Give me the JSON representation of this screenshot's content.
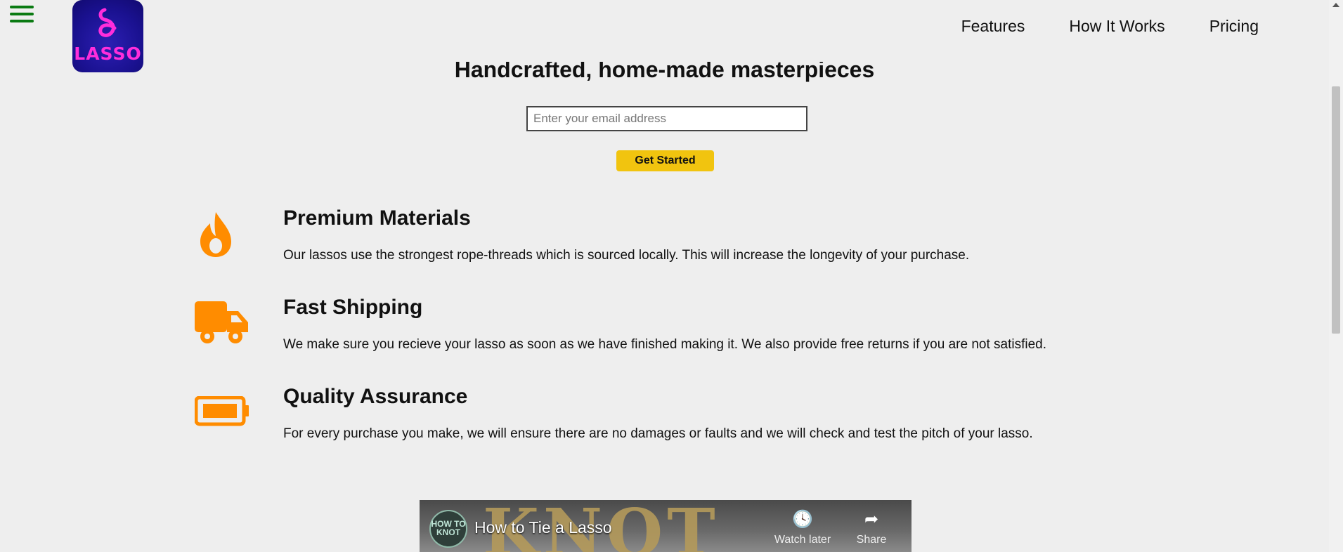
{
  "header": {
    "logo_text": "LASSO",
    "nav": [
      {
        "label": "Features"
      },
      {
        "label": "How It Works"
      },
      {
        "label": "Pricing"
      }
    ]
  },
  "hero": {
    "title": "Handcrafted, home-made masterpieces",
    "email_placeholder": "Enter your email address",
    "cta_label": "Get Started"
  },
  "features": [
    {
      "icon": "flame-icon",
      "title": "Premium Materials",
      "text": "Our lassos use the strongest rope-threads which is sourced locally. This will increase the longevity of your purchase."
    },
    {
      "icon": "truck-icon",
      "title": "Fast Shipping",
      "text": "We make sure you recieve your lasso as soon as we have finished making it. We also provide free returns if you are not satisfied."
    },
    {
      "icon": "battery-icon",
      "title": "Quality Assurance",
      "text": "For every purchase you make, we will ensure there are no damages or faults and we will check and test the pitch of your lasso."
    }
  ],
  "video": {
    "title": "How to Tie a Lasso",
    "background_text": "KNOT",
    "channel_avatar_text": "HOW TO KNOT",
    "watch_later_label": "Watch later",
    "share_label": "Share"
  },
  "colors": {
    "background": "#eeeeee",
    "accent_icon": "#ff8c00",
    "cta": "#f1c40f",
    "hamburger": "#0a7a12",
    "logo_bg": "#1a1190",
    "logo_text": "#ff2ddb"
  }
}
